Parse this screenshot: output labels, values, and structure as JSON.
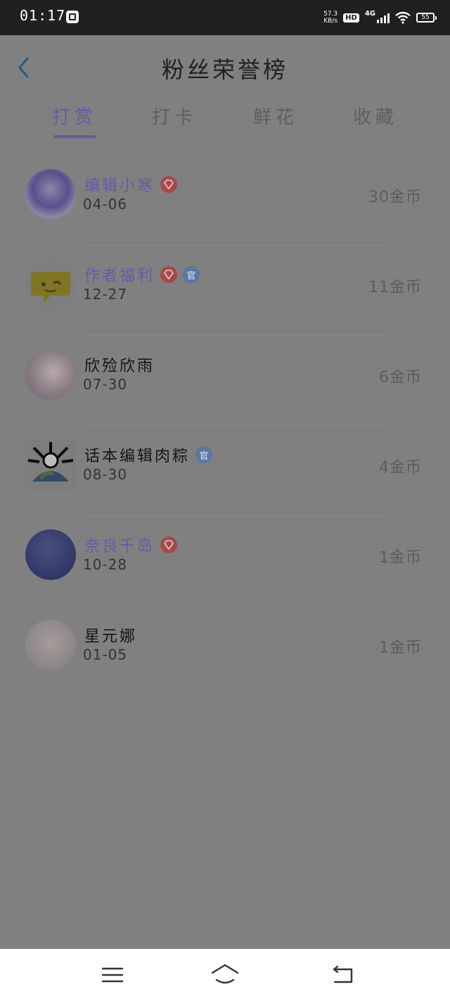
{
  "status_bar": {
    "time": "01:17",
    "net_speed_value": "57.3",
    "net_speed_unit": "KB/s",
    "hd": "HD",
    "network": "4G",
    "battery": "55"
  },
  "header": {
    "title": "粉丝荣誉榜"
  },
  "tabs": [
    {
      "label": "打赏",
      "active": true
    },
    {
      "label": "打卡",
      "active": false
    },
    {
      "label": "鲜花",
      "active": false
    },
    {
      "label": "收藏",
      "active": false
    }
  ],
  "fans": [
    {
      "name": "编辑小寒",
      "date": "04-06",
      "amount": "30金币",
      "vip": true,
      "official": false
    },
    {
      "name": "作者福利",
      "date": "12-27",
      "amount": "11金币",
      "vip": true,
      "official": true,
      "official_label": "官"
    },
    {
      "name": "欣殓欣雨",
      "date": "07-30",
      "amount": "6金币",
      "vip": false,
      "official": false
    },
    {
      "name": "话本编辑肉粽",
      "date": "08-30",
      "amount": "4金币",
      "vip": false,
      "official": true,
      "official_label": "官"
    },
    {
      "name": "奈良千岛",
      "date": "10-28",
      "amount": "1金币",
      "vip": true,
      "official": false
    },
    {
      "name": "星元娜",
      "date": "01-05",
      "amount": "1金币",
      "vip": false,
      "official": false
    }
  ],
  "colors": {
    "accent": "#6a58a0",
    "overlay": "#808080",
    "gem_badge": "#a44a4a",
    "official_badge": "#5877a2"
  },
  "icons": {
    "back": "back-arrow-icon",
    "gem": "diamond-icon",
    "nav_menu": "menu-icon",
    "nav_home": "home-icon",
    "nav_back": "return-icon"
  }
}
